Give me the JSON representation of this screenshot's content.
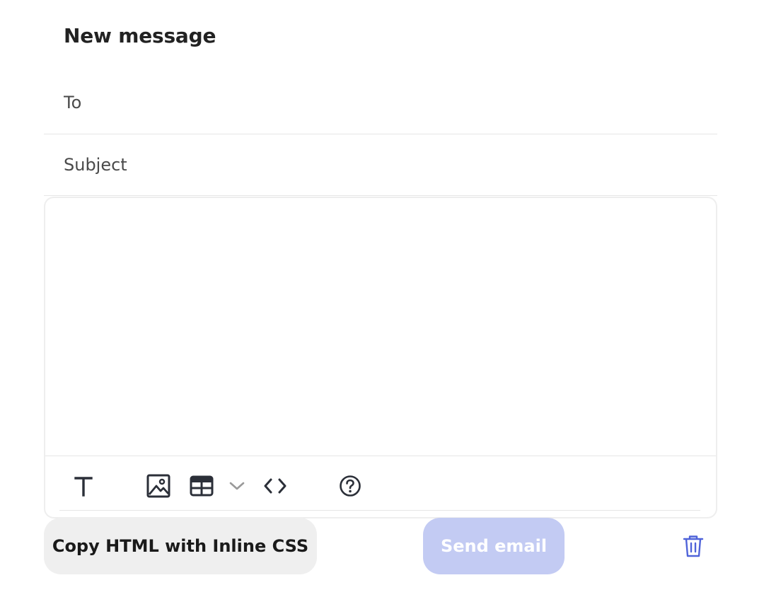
{
  "composer": {
    "title": "New message",
    "to_placeholder": "To",
    "subject_placeholder": "Subject"
  },
  "toolbar": {
    "icons": [
      "text-format-icon",
      "image-icon",
      "table-icon",
      "chevron-down-icon",
      "code-icon",
      "help-icon"
    ]
  },
  "actions": {
    "copy_label": "Copy HTML with Inline CSS",
    "send_label": "Send email",
    "send_color": "#c3cbf3",
    "delete_icon": "trash-icon",
    "accent_color": "#4f63d9"
  }
}
